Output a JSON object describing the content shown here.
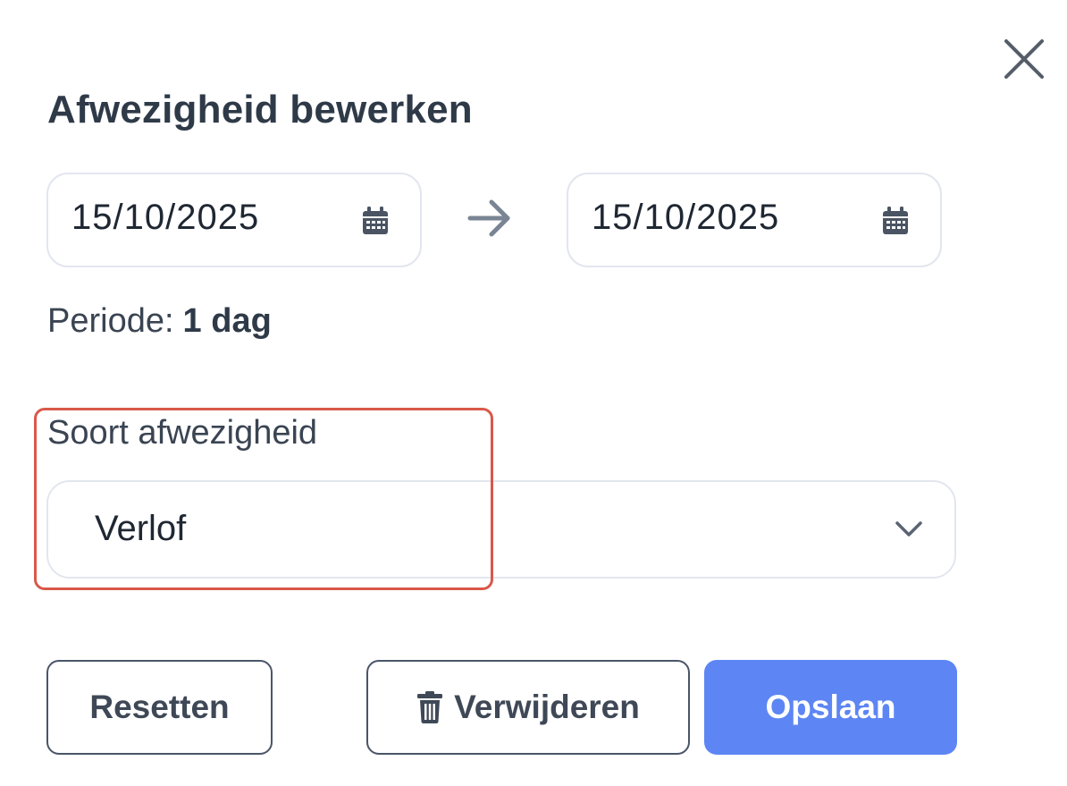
{
  "dialog": {
    "title": "Afwezigheid bewerken",
    "close_icon": "close-icon"
  },
  "dates": {
    "from": "15/10/2025",
    "to": "15/10/2025",
    "calendar_icon": "calendar-icon",
    "arrow_icon": "arrow-right-icon"
  },
  "period": {
    "label": "Periode:",
    "value": "1 dag"
  },
  "absence_type": {
    "label": "Soort afwezigheid",
    "value": "Verlof",
    "chevron_icon": "chevron-down-icon"
  },
  "buttons": {
    "reset": "Resetten",
    "delete": "Verwijderen",
    "delete_icon": "trash-icon",
    "save": "Opslaan"
  },
  "colors": {
    "primary": "#5d86f4",
    "highlight": "#d9584a",
    "text": "#2f3a48"
  }
}
